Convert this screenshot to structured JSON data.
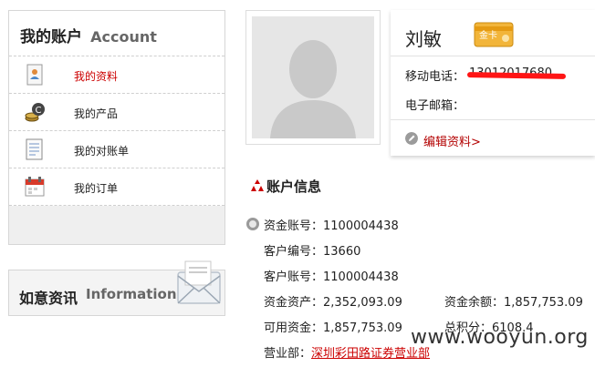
{
  "account_menu": {
    "title_cn": "我的账户",
    "title_en": "Account",
    "items": [
      {
        "label": "我的资料",
        "icon": "profile-card-icon",
        "active": true
      },
      {
        "label": "我的产品",
        "icon": "product-coins-icon",
        "active": false
      },
      {
        "label": "我的对账单",
        "icon": "statement-document-icon",
        "active": false
      },
      {
        "label": "我的订单",
        "icon": "calendar-order-icon",
        "active": false
      }
    ]
  },
  "news": {
    "title_cn": "如意资讯",
    "title_en": "Information",
    "icon": "mail-envelope-icon"
  },
  "profile": {
    "name": "刘敏",
    "badge": "金卡",
    "phone_label": "移动电话：",
    "phone_value": "13012017680",
    "email_label": "电子邮箱：",
    "edit_label": "编辑资料>"
  },
  "account_info": {
    "title": "账户信息",
    "fields": {
      "fund_account": {
        "label": "资金账号：",
        "value": "1100004438"
      },
      "customer_no": {
        "label": "客户编号：",
        "value": "13660"
      },
      "customer_account": {
        "label": "客户账号：",
        "value": "1100004438"
      },
      "fund_assets": {
        "label": "资金资产：",
        "value": "2,352,093.09"
      },
      "fund_balance": {
        "label": "资金余额：",
        "value": "1,857,753.09"
      },
      "available_funds": {
        "label": "可用资金：",
        "value": "1,857,753.09"
      },
      "total_points": {
        "label": "总积分：",
        "value": "6108.4"
      },
      "branch": {
        "label": "营业部：",
        "value": "深圳彩田路证券营业部"
      }
    }
  },
  "watermark": "www.wooyun.org",
  "colors": {
    "accent_red": "#cc0000",
    "link_dark_red": "#b30000",
    "redaction": "#ff1515"
  }
}
